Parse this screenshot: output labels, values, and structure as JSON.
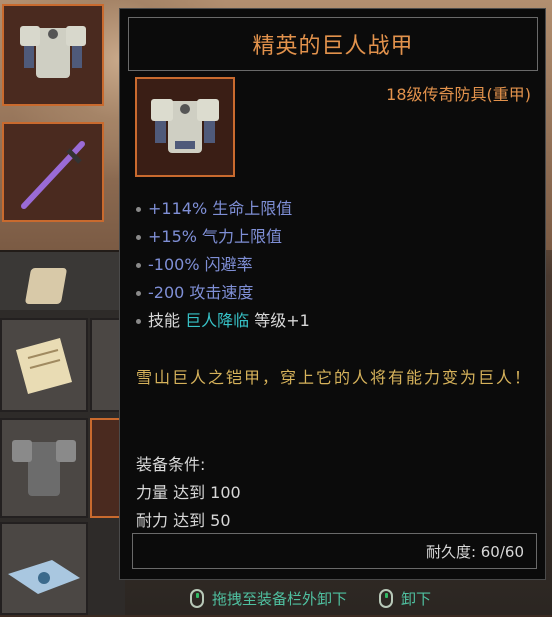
{
  "item": {
    "name": "精英的巨人战甲",
    "level_type": "18级传奇防具(重甲)"
  },
  "stats": [
    {
      "text": "+114% 生命上限值"
    },
    {
      "text": "+15% 气力上限值"
    },
    {
      "text": "-100% 闪避率"
    },
    {
      "text": "-200 攻击速度"
    }
  ],
  "skill": {
    "prefix": "技能",
    "name": "巨人降临",
    "suffix": "等级+1"
  },
  "description": "雪山巨人之铠甲，穿上它的人将有能力变为巨人！",
  "requirements": {
    "title": "装备条件:",
    "items": [
      "力量 达到 100",
      "耐力 达到 50"
    ]
  },
  "durability": "耐久度: 60/60",
  "hints": {
    "drag": "拖拽至装备栏外卸下",
    "unequip": "卸下"
  },
  "colors": {
    "title": "#e2924c",
    "stat": "#7f8fd6",
    "skill": "#37c1c6",
    "desc": "#d6b25b"
  }
}
